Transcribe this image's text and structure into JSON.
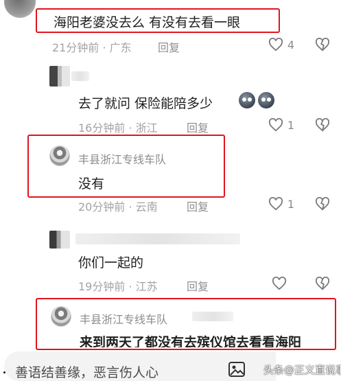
{
  "comments": [
    {
      "text": "海阳老婆没去么 有没有去看一眼",
      "time": "21分钟前",
      "location": "广东",
      "reply_label": "回复",
      "likes": "4"
    },
    {
      "text": "去了就问 保险能陪多少",
      "time": "16分钟前",
      "location": "浙江",
      "reply_label": "回复",
      "likes": "1",
      "emoji": "sweat-face-emoji"
    },
    {
      "username": "丰县浙江专线车队",
      "text": "没有",
      "time": "20分钟前",
      "location": "云南",
      "reply_label": "回复",
      "likes": "1"
    },
    {
      "text": "你们一起的",
      "time": "19分钟前",
      "location": "江苏",
      "reply_label": "回复",
      "likes": ""
    },
    {
      "username": "丰县浙江专线车队",
      "text": "来到两天了都没有去殡仪馆去看看海阳"
    }
  ],
  "input": {
    "placeholder": "善语结善缘，恶言伤人心"
  },
  "watermark": "头条@正义直说事",
  "colors": {
    "highlight_box": "#e0141e",
    "meta_text": "#a3a3a3"
  }
}
